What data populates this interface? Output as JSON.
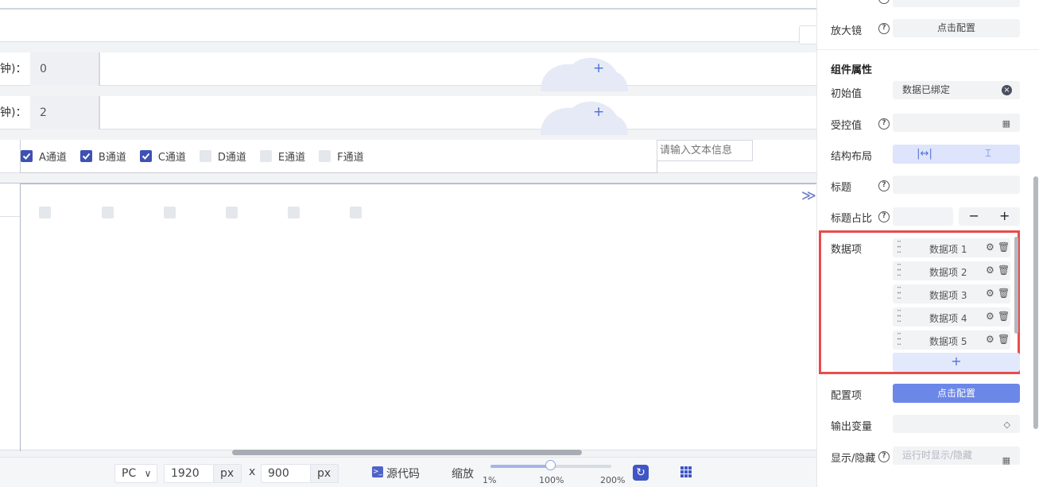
{
  "canvas": {
    "row2": {
      "label": "钟)：",
      "value": "0"
    },
    "row3": {
      "label": "钟)：",
      "value": "2"
    },
    "plus": "+",
    "checkboxes": [
      {
        "label": "A通道",
        "checked": true
      },
      {
        "label": "B通道",
        "checked": true
      },
      {
        "label": "C通道",
        "checked": true
      },
      {
        "label": "D通道",
        "checked": false
      },
      {
        "label": "E通道",
        "checked": false
      },
      {
        "label": "F通道",
        "checked": false
      }
    ],
    "text_input_placeholder": "请输入文本信息"
  },
  "toolbar": {
    "device": "PC",
    "device_arrow": "∨",
    "width": "1920",
    "height": "900",
    "unit": "px",
    "times": "x",
    "source_code": "源代码",
    "zoom_label": "缩放",
    "zoom_min": "1%",
    "zoom_mid": "100%",
    "zoom_max": "200%",
    "zoom_fraction": 0.5
  },
  "panel": {
    "magnifier": {
      "label": "放大镜",
      "button": "点击配置"
    },
    "section_title": "组件属性",
    "initial_value": {
      "label": "初始值",
      "value": "数据已绑定"
    },
    "controlled_value": {
      "label": "受控值"
    },
    "layout": {
      "label": "结构布局",
      "opt1": "|↔|",
      "opt2": "⌶"
    },
    "title": {
      "label": "标题"
    },
    "title_ratio": {
      "label": "标题占比",
      "minus": "−",
      "plus": "+"
    },
    "data_items": {
      "label": "数据项",
      "items": [
        "数据项 1",
        "数据项 2",
        "数据项 3",
        "数据项 4",
        "数据项 5"
      ],
      "add": "+"
    },
    "config": {
      "label": "配置项",
      "button": "点击配置"
    },
    "output_var": {
      "label": "输出变量"
    },
    "visibility": {
      "label": "显示/隐藏",
      "placeholder": "运行时显示/隐藏"
    }
  },
  "colors": {
    "accent": "#3e51b5",
    "primary_button": "#6b87e8",
    "highlight_frame": "#e84c4c"
  }
}
